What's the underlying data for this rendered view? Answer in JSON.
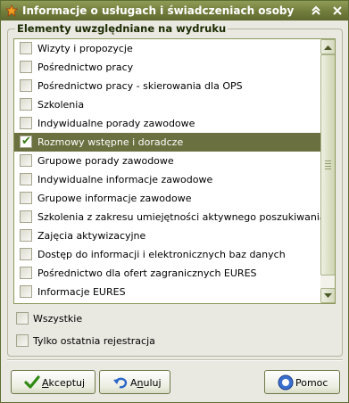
{
  "window": {
    "title": "Informacje o usługach i świadczeniach osoby"
  },
  "group": {
    "legend": "Elementy uwzględniane na wydruku"
  },
  "list": {
    "items": [
      {
        "label": "Wizyty i propozycje",
        "checked": false,
        "selected": false
      },
      {
        "label": "Pośrednictwo pracy",
        "checked": false,
        "selected": false
      },
      {
        "label": "Pośrednictwo pracy - skierowania dla OPS",
        "checked": false,
        "selected": false
      },
      {
        "label": "Szkolenia",
        "checked": false,
        "selected": false
      },
      {
        "label": "Indywidualne porady zawodowe",
        "checked": false,
        "selected": false
      },
      {
        "label": "Rozmowy wstępne i doradcze",
        "checked": true,
        "selected": true
      },
      {
        "label": "Grupowe porady zawodowe",
        "checked": false,
        "selected": false
      },
      {
        "label": "Indywidualne informacje zawodowe",
        "checked": false,
        "selected": false
      },
      {
        "label": "Grupowe informacje zawodowe",
        "checked": false,
        "selected": false
      },
      {
        "label": "Szkolenia z zakresu umiejętności aktywnego poszukiwania pracy",
        "checked": false,
        "selected": false
      },
      {
        "label": "Zajęcia aktywizacyjne",
        "checked": false,
        "selected": false
      },
      {
        "label": "Dostęp do informacji i elektronicznych baz danych",
        "checked": false,
        "selected": false
      },
      {
        "label": "Pośrednictwo dla ofert zagranicznych EURES",
        "checked": false,
        "selected": false
      },
      {
        "label": "Informacje EURES",
        "checked": false,
        "selected": false
      }
    ]
  },
  "options": {
    "all_label": "Wszystkie",
    "last_registration_label": "Tylko ostatnia rejestracja"
  },
  "buttons": {
    "accept_mnemonic": "A",
    "accept_rest": "kceptuj",
    "cancel_prefix": "A",
    "cancel_mnemonic": "n",
    "cancel_rest": "uluj",
    "help_label": "Pomoc"
  },
  "colors": {
    "title_bar": "#6f7a3a",
    "selected_row": "#6a703f",
    "check_mark": "#3c7a14"
  }
}
